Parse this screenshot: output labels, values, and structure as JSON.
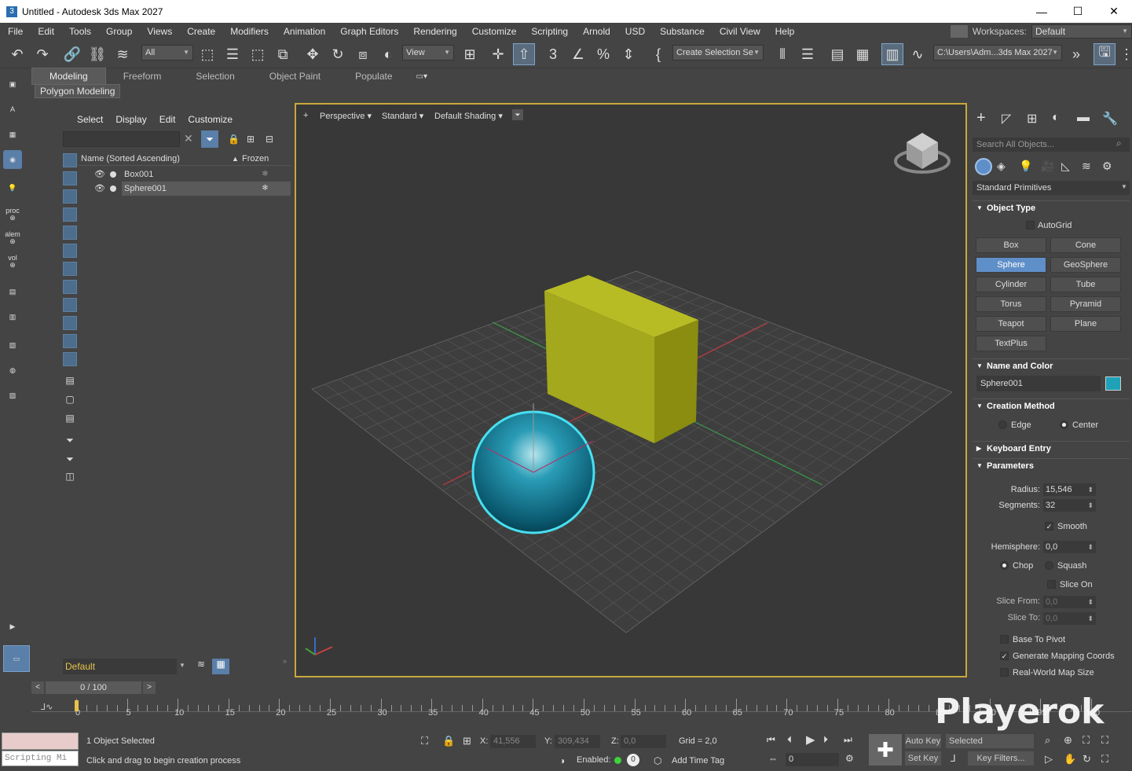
{
  "window": {
    "title": "Untitled - Autodesk 3ds Max 2027",
    "app_icon": "3",
    "min": "—",
    "max": "☐",
    "close": "✕"
  },
  "menu": [
    "File",
    "Edit",
    "Tools",
    "Group",
    "Views",
    "Create",
    "Modifiers",
    "Animation",
    "Graph Editors",
    "Rendering",
    "Customize",
    "Scripting",
    "Arnold",
    "USD",
    "Substance",
    "Civil View",
    "Help"
  ],
  "workspace": {
    "label": "Workspaces:",
    "value": "Default"
  },
  "toolbar": {
    "filter": "All",
    "refcoord": "View",
    "selset": "Create Selection Se",
    "path": "C:\\Users\\Adm...3ds Max 2027"
  },
  "ribbon": {
    "tabs": [
      "Modeling",
      "Freeform",
      "Selection",
      "Object Paint",
      "Populate"
    ],
    "active_panel": "Polygon Modeling"
  },
  "left_toolbar": {
    "proc": "proc",
    "alem": "alem",
    "vol": "vol"
  },
  "scene_explorer": {
    "menu": [
      "Select",
      "Display",
      "Edit",
      "Customize"
    ],
    "col_name": "Name (Sorted Ascending)",
    "col_sort": "▲",
    "col_frozen": "Frozen",
    "rows": [
      {
        "name": "Box001"
      },
      {
        "name": "Sphere001"
      }
    ],
    "layer": "Default"
  },
  "viewport": {
    "plus": "+",
    "view": "Perspective",
    "mode": "Standard",
    "shading": "Default Shading",
    "box_color": "#a4a81d",
    "sphere_color": "#1a8fa8",
    "select_color": "#48e0f0"
  },
  "command_panel": {
    "search_placeholder": "Search All Objects...",
    "category": "Standard Primitives",
    "object_type_title": "Object Type",
    "autogrid": "AutoGrid",
    "primitives": [
      "Box",
      "Cone",
      "Sphere",
      "GeoSphere",
      "Cylinder",
      "Tube",
      "Torus",
      "Pyramid",
      "Teapot",
      "Plane",
      "TextPlus"
    ],
    "active_primitive": "Sphere",
    "name_color_title": "Name and Color",
    "object_name": "Sphere001",
    "object_color": "#1fa2b8",
    "creation_method_title": "Creation Method",
    "method_edge": "Edge",
    "method_center": "Center",
    "keyboard_entry_title": "Keyboard Entry",
    "parameters_title": "Parameters",
    "radius_label": "Radius:",
    "radius": "15,546",
    "segments_label": "Segments:",
    "segments": "32",
    "smooth": "Smooth",
    "hemisphere_label": "Hemisphere:",
    "hemisphere": "0,0",
    "chop": "Chop",
    "squash": "Squash",
    "slice_on": "Slice On",
    "slice_from_label": "Slice From:",
    "slice_from": "0,0",
    "slice_to_label": "Slice To:",
    "slice_to": "0,0",
    "base_to_pivot": "Base To Pivot",
    "gen_mapping": "Generate Mapping Coords",
    "real_world": "Real-World Map Size"
  },
  "timeline": {
    "frame": "0 / 100",
    "ticks": [
      "0",
      "5",
      "10",
      "15",
      "20",
      "25",
      "30",
      "35",
      "40",
      "45",
      "50",
      "55",
      "60",
      "65",
      "70",
      "75",
      "80",
      "85",
      "90",
      "95",
      "100"
    ]
  },
  "status": {
    "selected": "1 Object Selected",
    "prompt": "Click and drag to begin creation process",
    "script_label": "Scripting Mi",
    "x_label": "X:",
    "x": "41,556",
    "y_label": "Y:",
    "y": "309,434",
    "z_label": "Z:",
    "z": "0,0",
    "grid": "Grid = 2,0",
    "enabled": "Enabled:",
    "enabled_value": "0",
    "add_time_tag": "Add Time Tag",
    "auto_key": "Auto Key",
    "set_key": "Set Key",
    "selected_dd": "Selected",
    "key_filters": "Key Filters...",
    "frame_field": "0"
  },
  "watermark": "Playerok"
}
